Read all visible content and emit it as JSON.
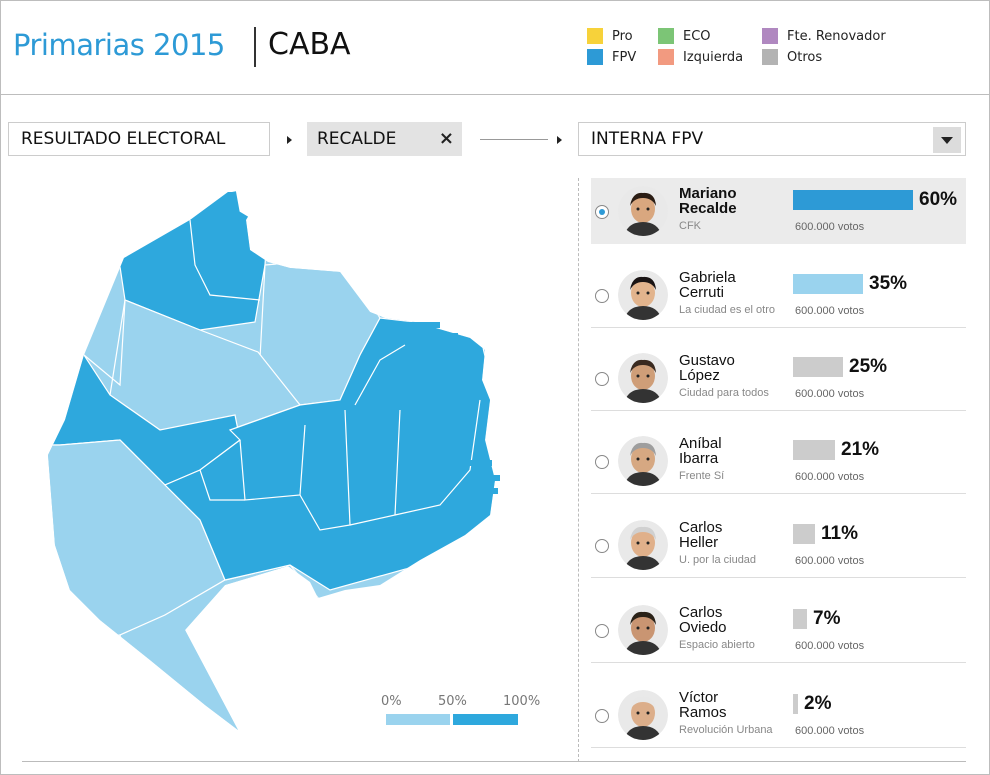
{
  "header": {
    "title": "Primarias 2015",
    "subtitle": "CABA"
  },
  "legend": [
    {
      "label": "Pro",
      "color": "#f7d23a"
    },
    {
      "label": "FPV",
      "color": "#2d9ad6"
    },
    {
      "label": "ECO",
      "color": "#7cc576"
    },
    {
      "label": "Izquierda",
      "color": "#f29a80"
    },
    {
      "label": "Fte. Renovador",
      "color": "#b088c0"
    },
    {
      "label": "Otros",
      "color": "#b3b3b3"
    }
  ],
  "filters": {
    "result_label": "RESULTADO ELECTORAL",
    "candidate_chip": "RECALDE",
    "chip_close": "×",
    "interna_label": "INTERNA FPV"
  },
  "candidates": [
    {
      "name_line1": "Mariano",
      "name_line2": "Recalde",
      "party": "CFK",
      "pct": "60%",
      "pct_value": 60,
      "votes": "600.000 votos",
      "bar_color": "#2d9ad6",
      "selected": true,
      "avatar_icon": "mariano-recalde-avatar"
    },
    {
      "name_line1": "Gabriela",
      "name_line2": "Cerruti",
      "party": "La ciudad es el otro",
      "pct": "35%",
      "pct_value": 35,
      "votes": "600.000 votos",
      "bar_color": "#9ad3ee",
      "selected": false,
      "avatar_icon": "gabriela-cerruti-avatar"
    },
    {
      "name_line1": "Gustavo",
      "name_line2": "López",
      "party": "Ciudad para todos",
      "pct": "25%",
      "pct_value": 25,
      "votes": "600.000 votos",
      "bar_color": "#cccccc",
      "selected": false,
      "avatar_icon": "gustavo-lopez-avatar"
    },
    {
      "name_line1": "Aníbal",
      "name_line2": "Ibarra",
      "party": "Frente Sí",
      "pct": "21%",
      "pct_value": 21,
      "votes": "600.000 votos",
      "bar_color": "#cccccc",
      "selected": false,
      "avatar_icon": "anibal-ibarra-avatar"
    },
    {
      "name_line1": "Carlos",
      "name_line2": "Heller",
      "party": "U. por la ciudad",
      "pct": "11%",
      "pct_value": 11,
      "votes": "600.000 votos",
      "bar_color": "#cccccc",
      "selected": false,
      "avatar_icon": "carlos-heller-avatar"
    },
    {
      "name_line1": "Carlos",
      "name_line2": "Oviedo",
      "party": "Espacio abierto",
      "pct": "7%",
      "pct_value": 7,
      "votes": "600.000 votos",
      "bar_color": "#cccccc",
      "selected": false,
      "avatar_icon": "carlos-oviedo-avatar"
    },
    {
      "name_line1": "Víctor",
      "name_line2": "Ramos",
      "party": "Revolución Urbana",
      "pct": "2%",
      "pct_value": 2,
      "votes": "600.000 votos",
      "bar_color": "#cccccc",
      "selected": false,
      "avatar_icon": "victor-ramos-avatar"
    }
  ],
  "map_scale": {
    "labels": [
      "0%",
      "50%",
      "100%"
    ],
    "colors": [
      "#9ad3ee",
      "#2ea8dd"
    ]
  }
}
